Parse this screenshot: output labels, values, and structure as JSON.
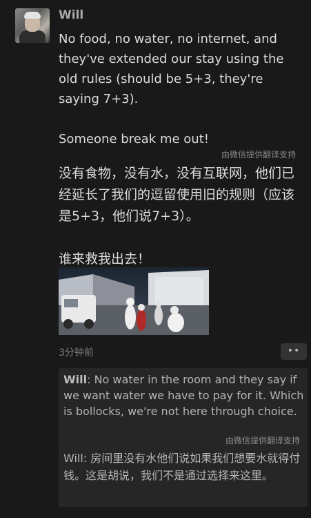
{
  "message": {
    "sender": "Will",
    "text_en_lines": [
      "No food, no water, no internet, and they've extended our stay using the old rules (should be 5+3, they're saying 7+3).",
      "Someone break me out!"
    ],
    "translation_note": "由微信提供翻译支持",
    "text_zh_lines": [
      "没有食物，没有水，没有互联网，他们已经延长了我们的逗留使用旧的规则（应该是5+3，他们说7+3）。",
      "谁来救我出去！"
    ],
    "timestamp": "3分钟前",
    "more_label": "••"
  },
  "quoted": {
    "sender": "Will",
    "text_en": ": No water in the room and they say if we want water we have to pay for it. Which is bollocks, we're not here through choice.",
    "translation_note": "由微信提供翻译支持",
    "text_zh": "Will: 房间里没有水他们说如果我们想要水就得付钱。这是胡说，我们不是通过选择来这里。"
  }
}
